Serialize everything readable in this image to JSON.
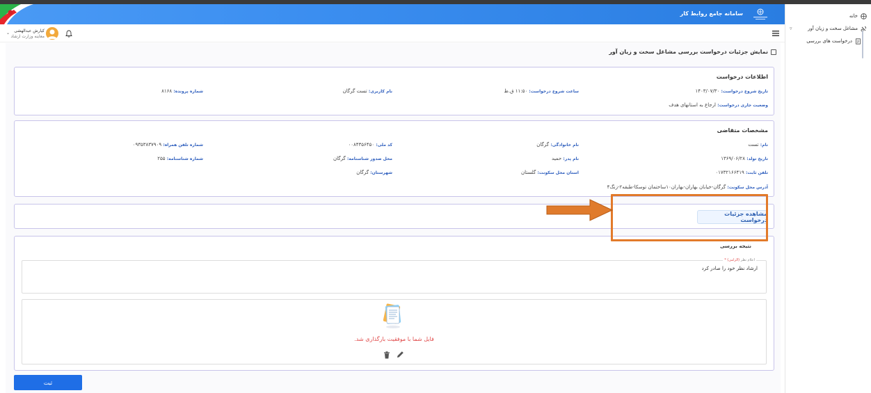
{
  "header": {
    "title": "سامانه جامع روابط کار"
  },
  "sidebar": {
    "items": [
      {
        "label": "خانه",
        "icon": "grid-icon"
      },
      {
        "label": "مشاغل سخت و زیان آور",
        "icon": "settings-icon"
      },
      {
        "label": "درخواست های بررسی",
        "icon": "document-icon"
      }
    ]
  },
  "user": {
    "name": "کیارش عبدالهشی",
    "role": "معاینه وزارت ارشاد"
  },
  "page": {
    "title": "نمایش جزئیات درخواست بررسی مشاغل سخت و زیان آور"
  },
  "request_info": {
    "title": "اطلاعات درخواست",
    "fields": [
      {
        "label": "تاریخ شروع درخواست:",
        "value": "۱۴۰۳/۰۷/۳۰"
      },
      {
        "label": "ساعت شروع درخواست:",
        "value": "۱۱:۵۰ ق.ظ"
      },
      {
        "label": "نام کاربری:",
        "value": "تست گرگان"
      },
      {
        "label": "شماره پرونده:",
        "value": "۸۱۶۸"
      },
      {
        "label": "وضعیت جاری درخواست:",
        "value": "ارجاع به استانهای هدف"
      }
    ]
  },
  "applicant": {
    "title": "مشخصات متقاضی",
    "fields": [
      {
        "label": "نام:",
        "value": "تست"
      },
      {
        "label": "نام خانوادگی:",
        "value": "گرگان"
      },
      {
        "label": "کد ملی:",
        "value": "۰۰۸۴۳۵۶۴۵۰"
      },
      {
        "label": "شماره تلفن همراه:",
        "value": "۰۹۳۵۳۸۳۷۹۰۹"
      },
      {
        "label": "تاریخ تولد:",
        "value": "۱۳۶۹/۰۶/۲۸"
      },
      {
        "label": "نام پدر:",
        "value": "حمید"
      },
      {
        "label": "محل صدور شناسنامه:",
        "value": "گرگان"
      },
      {
        "label": "شماره شناسنامه:",
        "value": "۲۵۵"
      },
      {
        "label": "تلفن ثابت:",
        "value": "۰۱۷۳۲۱۶۶۴۱۹"
      },
      {
        "label": "استان محل سکونت:",
        "value": "گلستان"
      },
      {
        "label": "شهرستان:",
        "value": "گرگان"
      },
      {
        "label": "آدرس محل سکونت:",
        "value": "گرگان-خیابان بهاران-بهاران۱۰ساختمان توسکا-طبقه۲-زنگ۴"
      }
    ]
  },
  "details_button": {
    "label": "مشاهده جزئیات درخواست"
  },
  "review": {
    "title": "نتیجه بررسی",
    "field_label": "اعلام نظر",
    "required_mark": "(الزامی) *",
    "field_value": "ارشاد نظر خود را صادر کرد",
    "upload_message": "فایل شما با موفقیت بارگذاری شد."
  },
  "submit_button": {
    "label": "ثبت"
  },
  "colors": {
    "primary": "#1f6ee6",
    "card_border": "#c8c4ea",
    "highlight": "#e27a2a",
    "label_blue": "#2f5fbe",
    "error_red": "#e04848"
  }
}
